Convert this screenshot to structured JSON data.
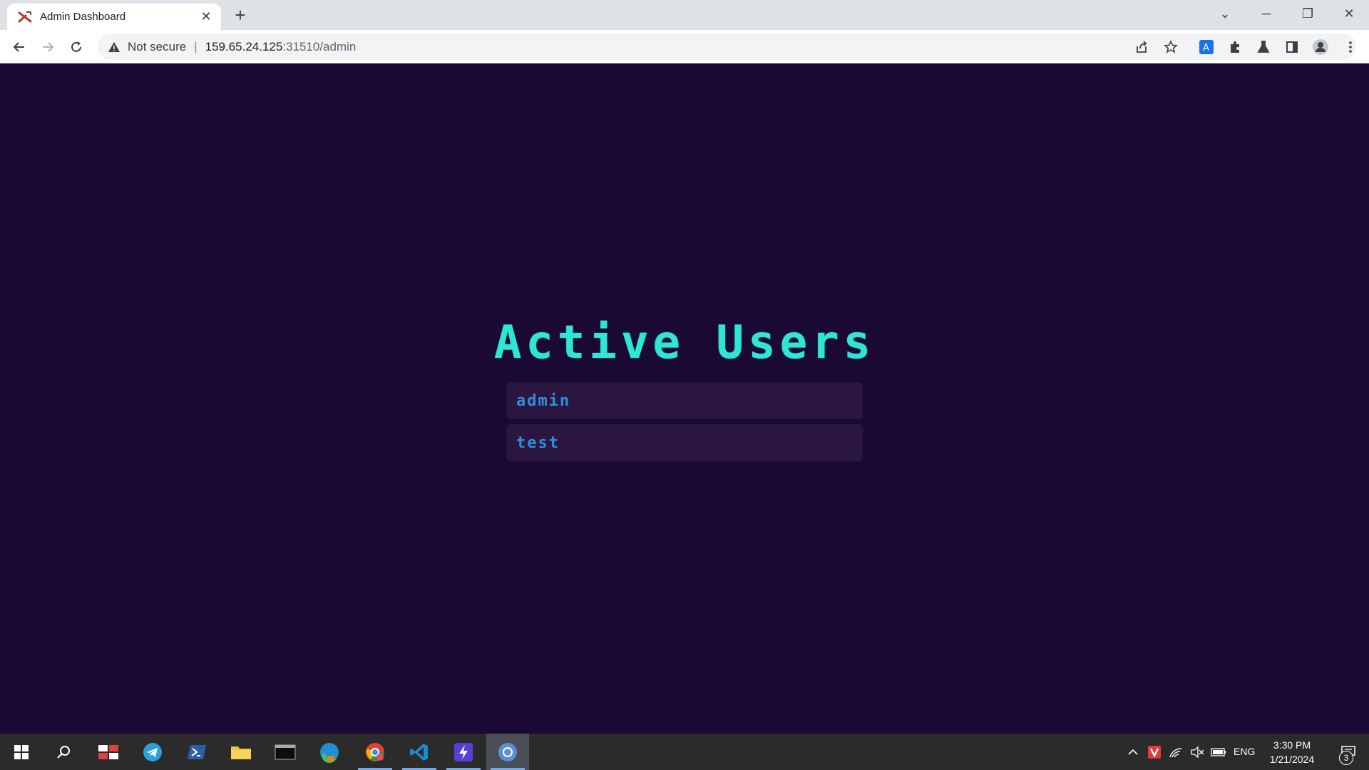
{
  "browser": {
    "tab_title": "Admin Dashboard",
    "tab_close": "✕",
    "new_tab": "+",
    "security_label": "Not secure",
    "separator": "|",
    "url_host": "159.65.24.125",
    "url_path": ":31510/admin",
    "window_controls": {
      "list": "⌄",
      "minimize": "─",
      "restore": "❐",
      "close": "✕"
    }
  },
  "page": {
    "title": "Active Users",
    "users": [
      {
        "name": "admin"
      },
      {
        "name": "test"
      }
    ]
  },
  "taskbar": {
    "apps": [
      "windows-start",
      "search",
      "task-view",
      "telegram",
      "powershell",
      "file-explorer",
      "terminal",
      "edge",
      "chrome-profile",
      "vscode",
      "app-bolt",
      "chrome"
    ],
    "language": "ENG",
    "time": "3:30 PM",
    "date": "1/21/2024",
    "notifications": "3"
  },
  "colors": {
    "page_bg": "#1a0a33",
    "title": "#2ee6d6",
    "user_text": "#2f8fdc",
    "user_item_bg": "#2a1640"
  }
}
